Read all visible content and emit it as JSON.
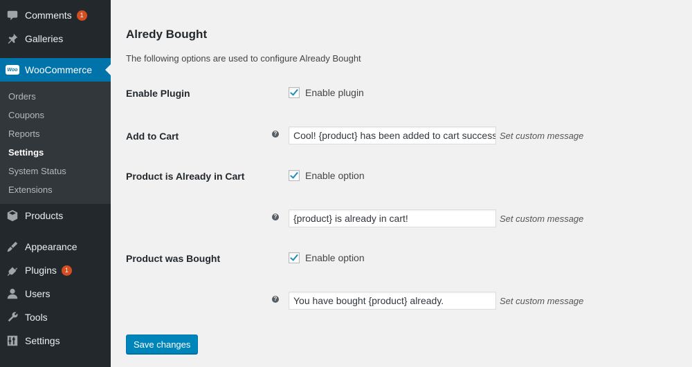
{
  "sidebar": {
    "items": [
      {
        "label": "Comments",
        "icon": "comment-icon",
        "badge": "1"
      },
      {
        "label": "Galleries",
        "icon": "pushpin-icon"
      },
      {
        "label": "WooCommerce",
        "icon": "woocommerce-icon",
        "logo_text": "Woo"
      },
      {
        "label": "Products",
        "icon": "box-icon"
      },
      {
        "label": "Appearance",
        "icon": "paintbrush-icon"
      },
      {
        "label": "Plugins",
        "icon": "plug-icon",
        "badge": "1"
      },
      {
        "label": "Users",
        "icon": "user-icon"
      },
      {
        "label": "Tools",
        "icon": "wrench-icon"
      },
      {
        "label": "Settings",
        "icon": "sliders-icon"
      }
    ],
    "submenu": [
      "Orders",
      "Coupons",
      "Reports",
      "Settings",
      "System Status",
      "Extensions"
    ],
    "active_submenu": "Settings"
  },
  "main": {
    "title": "Alredy Bought",
    "description": "The following options are used to configure Already Bought",
    "enable_plugin": {
      "label": "Enable Plugin",
      "checkbox_label": "Enable plugin",
      "checked": true
    },
    "add_to_cart": {
      "label": "Add to Cart",
      "value": "Cool! {product} has been added to cart successfully",
      "hint": "Set custom message"
    },
    "already_in_cart": {
      "label": "Product is Already in Cart",
      "checkbox_label": "Enable option",
      "checked": true,
      "value": "{product} is already in cart!",
      "hint": "Set custom message"
    },
    "was_bought": {
      "label": "Product was Bought",
      "checkbox_label": "Enable option",
      "checked": true,
      "value": "You have bought {product} already.",
      "hint": "Set custom message"
    },
    "help_glyph": "?",
    "save_label": "Save changes"
  },
  "colors": {
    "sidebar_bg": "#23282d",
    "submenu_bg": "#32373c",
    "accent": "#0073aa",
    "button": "#0085ba",
    "badge": "#d54e21",
    "page_bg": "#f1f1f1"
  }
}
